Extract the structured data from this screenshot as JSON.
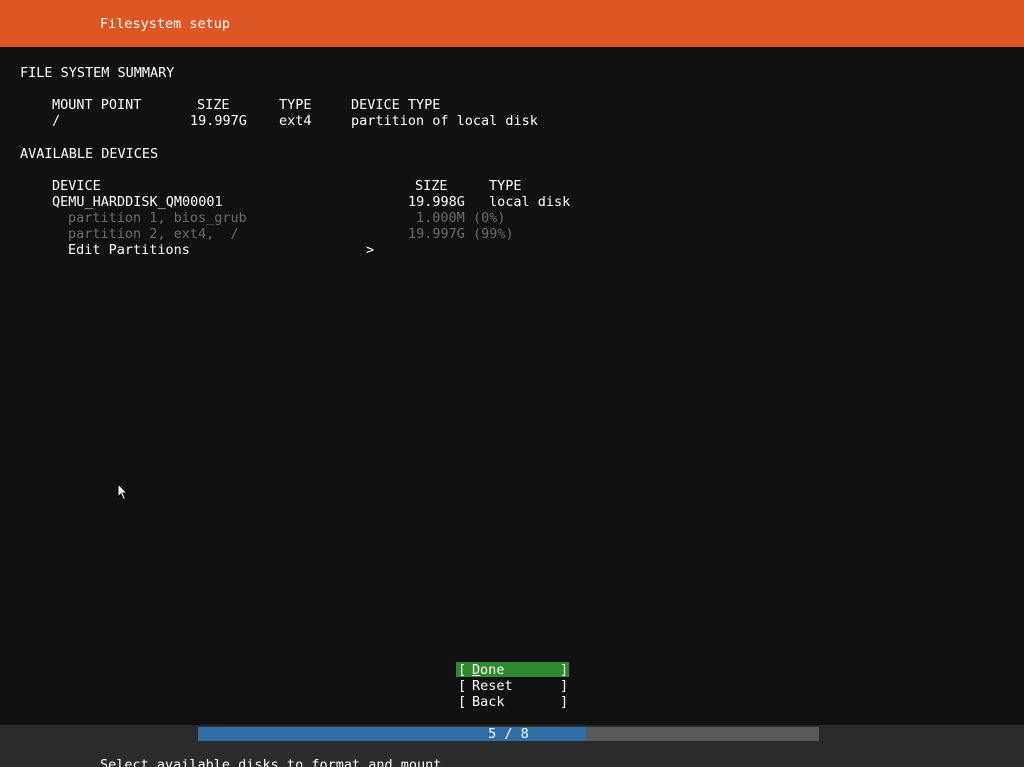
{
  "header": {
    "title": "Filesystem setup"
  },
  "summary": {
    "heading": "FILE SYSTEM SUMMARY",
    "columns": {
      "mount_point": "MOUNT POINT",
      "size": "SIZE",
      "type": "TYPE",
      "device_type": "DEVICE TYPE"
    },
    "rows": [
      {
        "mount_point": "/",
        "size": "19.997G",
        "type": "ext4",
        "device_type": "partition of local disk"
      }
    ]
  },
  "devices": {
    "heading": "AVAILABLE DEVICES",
    "columns": {
      "device": "DEVICE",
      "size": "SIZE",
      "type": "TYPE"
    },
    "disk": {
      "name": "QEMU_HARDDISK_QM00001",
      "size": "19.998G",
      "type": "local disk"
    },
    "partitions": [
      {
        "label": "partition 1, bios_grub",
        "size": "1.000M",
        "pct": "(0%)"
      },
      {
        "label": "partition 2, ext4,  /",
        "size": "19.997G",
        "pct": "(99%)"
      }
    ],
    "edit": {
      "label": "Edit Partitions",
      "arrow": ">"
    }
  },
  "buttons": {
    "done": {
      "open": "[ ",
      "accel": "D",
      "rest": "one",
      "close": "]"
    },
    "reset": {
      "open": "[ ",
      "label": "Reset",
      "close": "]"
    },
    "back": {
      "open": "[ ",
      "label": "Back",
      "close": "]"
    }
  },
  "progress": {
    "text": "5 / 8",
    "current": 5,
    "total": 8,
    "fill_fraction": 0.625,
    "fill_color": "#2f6fa6"
  },
  "status": {
    "text": "Select available disks to format and mount"
  },
  "colors": {
    "header": "#dd5625",
    "done_button": "#2f8a2f",
    "background": "#111111"
  }
}
